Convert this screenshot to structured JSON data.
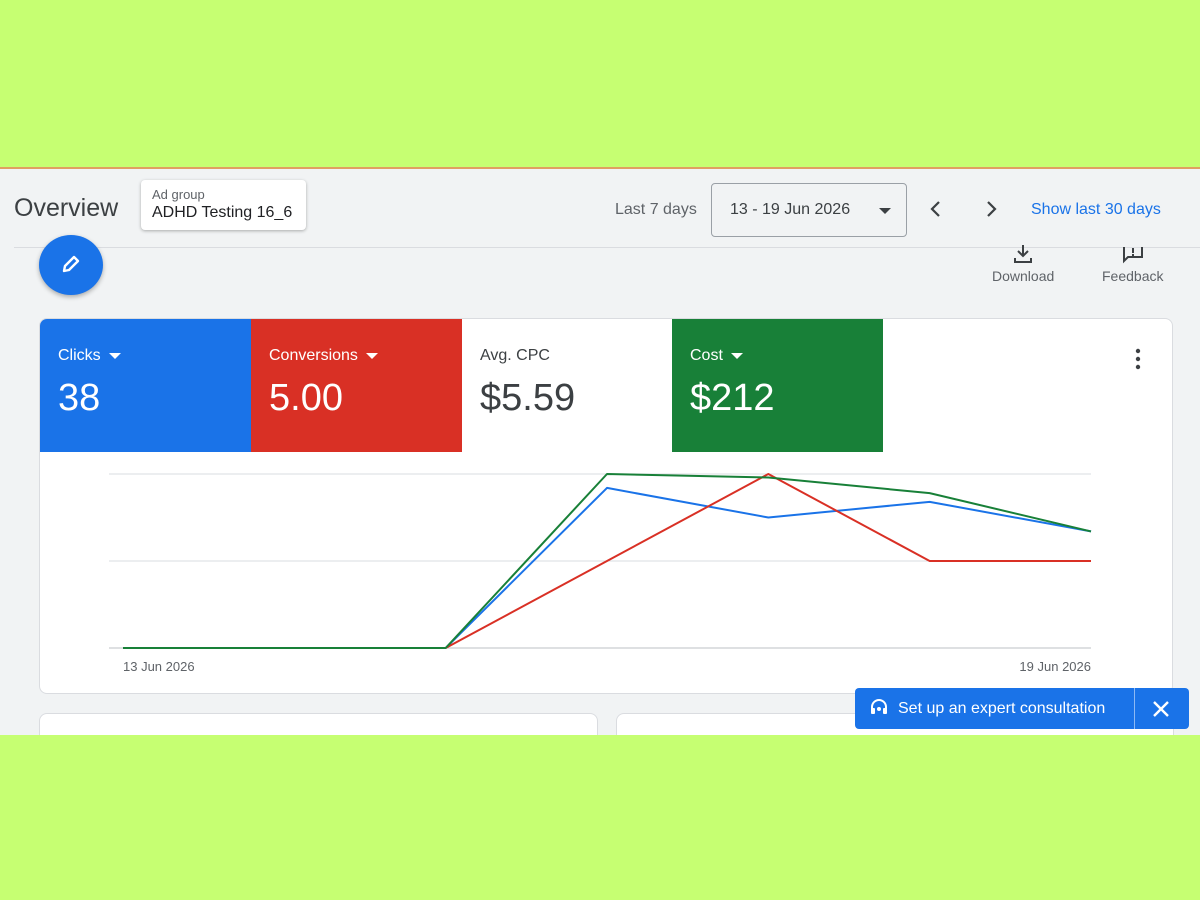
{
  "header": {
    "title": "Overview",
    "ad_group_label": "Ad group",
    "ad_group_value": "ADHD Testing 16_6",
    "range_label": "Last 7 days",
    "date_range": "13 - 19 Jun 2026",
    "show_30_label": "Show last 30 days"
  },
  "toolbar": {
    "download_label": "Download",
    "feedback_label": "Feedback"
  },
  "metrics": [
    {
      "label": "Clicks",
      "value": "38",
      "color": "#1a73e8"
    },
    {
      "label": "Conversions",
      "value": "5.00",
      "color": "#d93025"
    },
    {
      "label": "Avg. CPC",
      "value": "$5.59",
      "color": "#ffffff"
    },
    {
      "label": "Cost",
      "value": "$212",
      "color": "#188038"
    }
  ],
  "chart_data": {
    "type": "line",
    "x": [
      "13 Jun 2026",
      "14 Jun 2026",
      "15 Jun 2026",
      "16 Jun 2026",
      "17 Jun 2026",
      "18 Jun 2026",
      "19 Jun 2026"
    ],
    "x_tick_labels": [
      "13 Jun 2026",
      "19 Jun 2026"
    ],
    "grid": true,
    "series": [
      {
        "name": "Clicks",
        "color": "#1a73e8",
        "values": [
          0,
          0,
          0,
          0.92,
          0.75,
          0.84,
          0.67
        ]
      },
      {
        "name": "Conversions",
        "color": "#d93025",
        "values": [
          0,
          0,
          0,
          0.5,
          1.0,
          0.5,
          0.5
        ]
      },
      {
        "name": "Cost",
        "color": "#188038",
        "values": [
          0,
          0,
          0,
          1.0,
          0.98,
          0.89,
          0.67
        ]
      }
    ],
    "ylim": [
      0,
      1
    ]
  },
  "snackbar": {
    "text": "Set up an expert consultation"
  }
}
